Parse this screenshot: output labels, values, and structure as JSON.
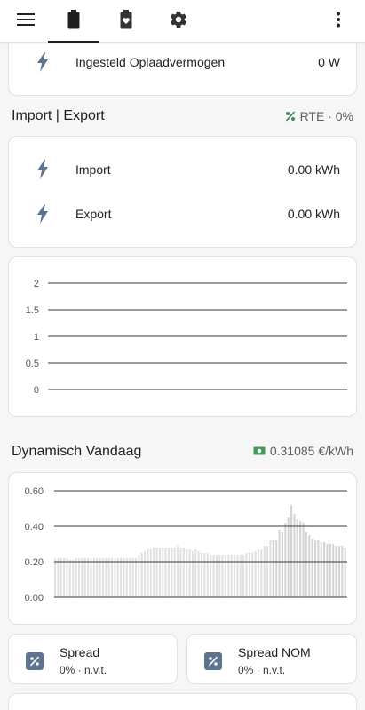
{
  "topbar": {
    "icons": [
      "menu-icon",
      "battery-icon",
      "battery-heart-icon",
      "settings-icon",
      "more-vert-icon"
    ],
    "active_tab": "battery"
  },
  "top_card": {
    "label": "Ingesteld Oplaadvermogen",
    "value": "0 W"
  },
  "import_export": {
    "title": "Import | Export",
    "rte_label": "RTE · 0%",
    "rows": [
      {
        "label": "Import",
        "value": "0.00 kWh"
      },
      {
        "label": "Export",
        "value": "0.00 kWh"
      }
    ]
  },
  "dynamic": {
    "title": "Dynamisch Vandaag",
    "price_label": "0.31085 €/kWh"
  },
  "chart_data": [
    {
      "type": "line",
      "y_ticks": [
        "2",
        "1.5",
        "1",
        "0.5",
        "0"
      ],
      "ylim": [
        0,
        2
      ],
      "grid": true,
      "series": []
    },
    {
      "type": "bar",
      "y_ticks": [
        "0.60",
        "0.40",
        "0.20",
        "0.00"
      ],
      "ylim": [
        0,
        0.6
      ],
      "grid": true,
      "values": [
        0.22,
        0.22,
        0.22,
        0.22,
        0.22,
        0.21,
        0.21,
        0.22,
        0.22,
        0.22,
        0.22,
        0.22,
        0.22,
        0.22,
        0.22,
        0.22,
        0.22,
        0.22,
        0.22,
        0.22,
        0.22,
        0.22,
        0.22,
        0.22,
        0.22,
        0.22,
        0.22,
        0.22,
        0.24,
        0.25,
        0.26,
        0.27,
        0.27,
        0.28,
        0.28,
        0.28,
        0.28,
        0.28,
        0.28,
        0.28,
        0.28,
        0.29,
        0.28,
        0.28,
        0.27,
        0.27,
        0.26,
        0.27,
        0.26,
        0.25,
        0.25,
        0.25,
        0.24,
        0.24,
        0.24,
        0.24,
        0.24,
        0.24,
        0.24,
        0.24,
        0.24,
        0.24,
        0.24,
        0.24,
        0.25,
        0.25,
        0.25,
        0.26,
        0.27,
        0.27,
        0.29,
        0.29,
        0.32,
        0.32,
        0.32,
        0.38,
        0.37,
        0.42,
        0.45,
        0.52,
        0.47,
        0.44,
        0.43,
        0.42,
        0.37,
        0.35,
        0.33,
        0.32,
        0.32,
        0.31,
        0.31,
        0.3,
        0.3,
        0.3,
        0.29,
        0.29,
        0.29,
        0.28
      ],
      "highlight_from_index": 73,
      "colors": {
        "normal": "#e1e1e1",
        "highlight": "#d4d4d4"
      }
    }
  ],
  "spread_cards": [
    {
      "title": "Spread",
      "sub": "0% · n.v.t."
    },
    {
      "title": "Spread NOM",
      "sub": "0% · n.v.t."
    }
  ],
  "colors": {
    "icon_blue": "#5d7490",
    "rte_green": "#3f8a5a",
    "money_green": "#3f9a5a"
  }
}
